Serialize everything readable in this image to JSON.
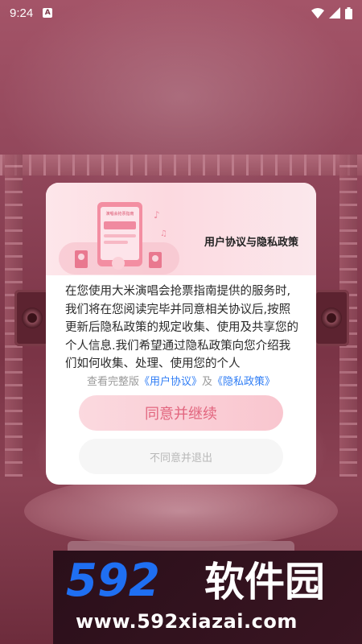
{
  "status_bar": {
    "time": "9:24",
    "notification_icon": "A",
    "icons": [
      "wifi-icon",
      "signal-icon",
      "battery-icon"
    ]
  },
  "dialog": {
    "title": "用户协议与隐私政策",
    "body": "在您使用大米演唱会抢票指南提供的服务时,我们将在您阅读完毕并同意相关协议后,按照更新后隐私政策的规定收集、使用及共享您的个人信息.我们希望通过隐私政策向您介绍我们如何收集、处理、使用您的个人",
    "links_prefix": "查看完整版",
    "user_agreement_link": "《用户协议》",
    "links_joiner": "及",
    "privacy_policy_link": "《隐私政策》",
    "agree_label": "同意并继续",
    "disagree_label": "不同意并退出",
    "illustration_sign": "演唱会抢票指南"
  },
  "watermark": {
    "logo_number": "592",
    "logo_text": "软件园",
    "url": "www.592xiazai.com"
  },
  "colors": {
    "accent": "#e2657e",
    "button_bg": "#f9c6cf",
    "link": "#2f7df5",
    "watermark_blue": "#1f6ff2"
  }
}
